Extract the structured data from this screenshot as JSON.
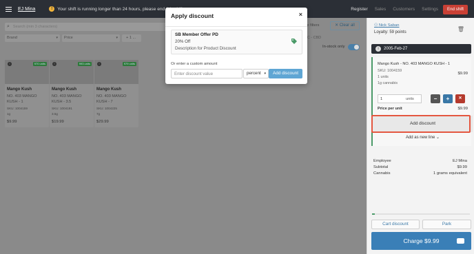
{
  "topbar": {
    "user_name": "EJ Mina",
    "warning_text": "Your shift is running longer than 24 hours, please end this shift.",
    "nav": [
      "Register",
      "Sales",
      "Customers",
      "Settings"
    ],
    "end_shift_label": "End shift"
  },
  "main": {
    "search_placeholder": "Search (min 3 characters)",
    "filters": [
      {
        "label": "Brand"
      },
      {
        "label": "Price"
      },
      {
        "label": "+ 1 ..."
      }
    ],
    "hide_filters_label": "ide filters",
    "clear_all_label": "Clear all",
    "range_text": "HC - CBD",
    "instock_label": "In-stock only",
    "products": [
      {
        "badge": "970 units",
        "name": "Mango Kush",
        "desc": "NO. 403 MANGO KUSH - 1",
        "sku": "SKU: 1004159",
        "weight": "1g",
        "price": "$9.99"
      },
      {
        "badge": "993 units",
        "name": "Mango Kush",
        "desc": "NO. 403 MANGO KUSH - 3.5",
        "sku": "SKU: 1004191",
        "weight": "3.5g",
        "price": "$19.99"
      },
      {
        "badge": "979 units",
        "name": "Mango Kush",
        "desc": "NO. 403 MANGO KUSH - 7",
        "sku": "SKU: 1004225",
        "weight": "7g",
        "price": "$29.99"
      }
    ]
  },
  "cart": {
    "customer": "Nick Saban",
    "loyalty": "Loyalty: 59 points",
    "date": "2005-Feb-27",
    "item": {
      "title": "Mango Kush - NO. 403 MANGO KUSH - 1",
      "sku": "SKU: 1004159",
      "price": "$9.99",
      "units_text": "1 units",
      "cannabis_text": "1g cannabis",
      "qty_value": "1",
      "qty_unit": "units",
      "ppu_label": "Price per unit",
      "ppu_value": "$9.99",
      "add_discount_label": "Add discount",
      "add_new_line_label": "Add as new line"
    },
    "summary": [
      {
        "label": "Employee",
        "value": "EJ Mina"
      },
      {
        "label": "Subtotal",
        "value": "$9.99"
      },
      {
        "label": "Cannabis",
        "value": "1 grams equivalent"
      }
    ],
    "progress_fraction": 0.03,
    "cart_discount_label": "Cart discount",
    "park_label": "Park",
    "charge_label": "Charge $9.99"
  },
  "modal": {
    "title": "Apply discount",
    "close": "×",
    "offer": {
      "title": "SB Member Offer PD",
      "percent": "20% Off",
      "description": "Description for Product Discount"
    },
    "custom_label": "Or enter a custom amount",
    "input_placeholder": "Enter discount value",
    "select_value": "percent",
    "apply_label": "Add discount"
  },
  "colors": {
    "accent": "#5fa6d4",
    "danger": "#c94035",
    "success": "#4a9a68",
    "highlight": "#e4563f"
  }
}
